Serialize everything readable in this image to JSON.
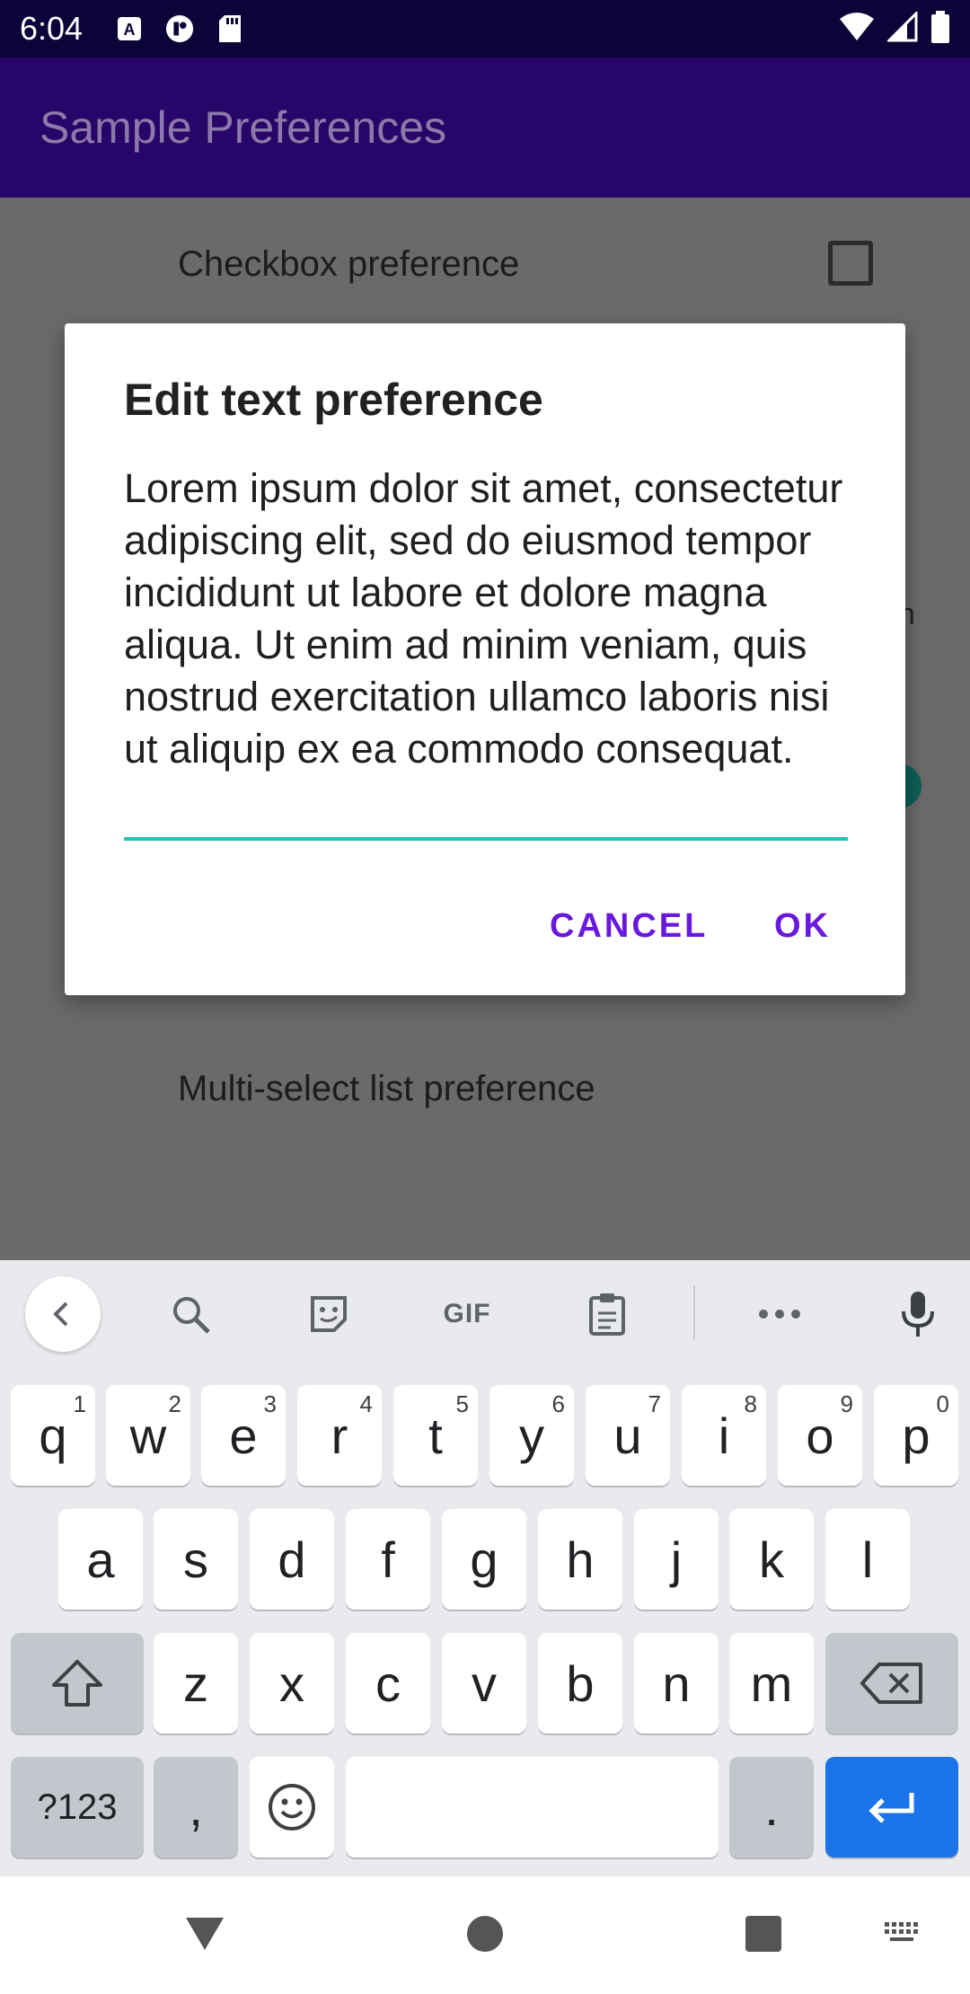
{
  "status_bar": {
    "time": "6:04",
    "left_icons": [
      "text-a-icon",
      "app-badge-icon",
      "sd-card-icon"
    ],
    "right_icons": [
      "wifi-icon",
      "cell-signal-icon",
      "battery-icon"
    ]
  },
  "app_bar": {
    "title": "Sample Preferences"
  },
  "background": {
    "checkbox_label": "Checkbox preference",
    "multiselect_label": "Multi-select list preference",
    "peek_char": "n"
  },
  "dialog": {
    "title": "Edit text preference",
    "field_value": "Lorem ipsum dolor sit amet, consectetur adipiscing elit, sed do eiusmod tempor incididunt ut labore et dolore magna aliqua. Ut enim ad minim veniam, quis nostrud exercitation ullamco laboris nisi ut aliquip ex ea commodo consequat.",
    "cancel_label": "CANCEL",
    "ok_label": "OK",
    "accent_color": "#6a18df",
    "underline_color": "#22c2b4"
  },
  "keyboard": {
    "toolbar": [
      "back-icon",
      "search-icon",
      "sticker-icon",
      "gif-icon",
      "clipboard-icon",
      "more-icon",
      "mic-icon"
    ],
    "gif_label": "GIF",
    "row1": [
      {
        "k": "q",
        "h": "1"
      },
      {
        "k": "w",
        "h": "2"
      },
      {
        "k": "e",
        "h": "3"
      },
      {
        "k": "r",
        "h": "4"
      },
      {
        "k": "t",
        "h": "5"
      },
      {
        "k": "y",
        "h": "6"
      },
      {
        "k": "u",
        "h": "7"
      },
      {
        "k": "i",
        "h": "8"
      },
      {
        "k": "o",
        "h": "9"
      },
      {
        "k": "p",
        "h": "0"
      }
    ],
    "row2": [
      "a",
      "s",
      "d",
      "f",
      "g",
      "h",
      "j",
      "k",
      "l"
    ],
    "row3": [
      "z",
      "x",
      "c",
      "v",
      "b",
      "n",
      "m"
    ],
    "symbols_label": "?123",
    "comma": ",",
    "period": ".",
    "enter_color": "#1a73e8"
  },
  "nav_bar": {
    "items": [
      "back-triangle-icon",
      "home-circle-icon",
      "recents-square-icon",
      "keyboard-switch-icon"
    ]
  }
}
